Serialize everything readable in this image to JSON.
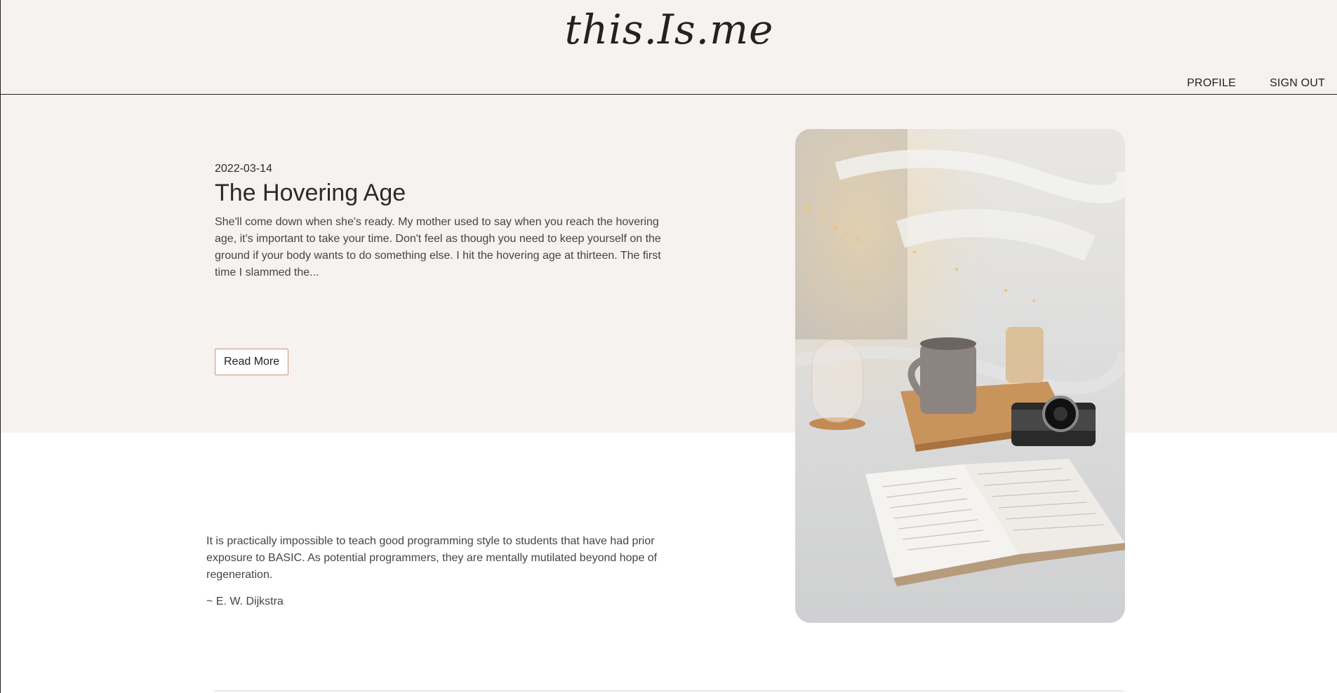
{
  "header": {
    "logo": "this.Is.me",
    "nav": {
      "profile": "PROFILE",
      "sign_out": "SIGN OUT"
    }
  },
  "post": {
    "date": "2022-03-14",
    "title": "The Hovering Age",
    "excerpt": "She'll come down when she's ready. My mother used to say when you reach the hovering age, it's important to take your time. Don't feel as though you need to keep yourself on the ground if your body wants to do something else. I hit the hovering age at thirteen. The first time I slammed the...",
    "read_more": "Read More"
  },
  "photo": {
    "subject": "book-coffee-camera-on-bed-photo"
  },
  "quote": {
    "text": "It is practically impossible to teach good programming style to students that have had prior exposure to BASIC. As potential programmers, they are mentally mutilated beyond hope of regeneration.",
    "author": "~ E. W. Dijkstra"
  },
  "colors": {
    "hero_background": "#f6f2ef",
    "button_border": "#c7967f",
    "text": "#2b2b2b"
  }
}
